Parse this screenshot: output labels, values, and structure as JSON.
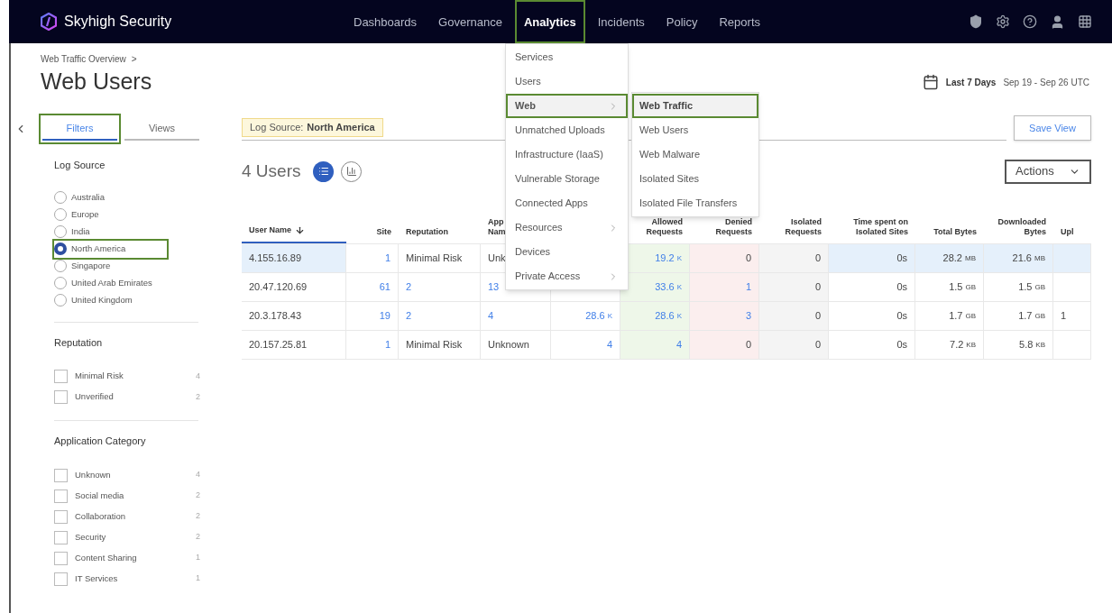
{
  "brand": "Skyhigh Security",
  "nav": [
    {
      "label": "Dashboards",
      "selected": false,
      "outlined": false
    },
    {
      "label": "Governance",
      "selected": false,
      "outlined": false
    },
    {
      "label": "Analytics",
      "selected": true,
      "outlined": true
    },
    {
      "label": "Incidents",
      "selected": false,
      "outlined": false
    },
    {
      "label": "Policy",
      "selected": false,
      "outlined": false
    },
    {
      "label": "Reports",
      "selected": false,
      "outlined": false
    }
  ],
  "menu": [
    {
      "label": "Services",
      "submenu": false,
      "selected": false
    },
    {
      "label": "Users",
      "submenu": false,
      "selected": false
    },
    {
      "label": "Web",
      "submenu": true,
      "selected": true
    },
    {
      "label": "Unmatched Uploads",
      "submenu": false,
      "selected": false
    },
    {
      "label": "Infrastructure (IaaS)",
      "submenu": false,
      "selected": false
    },
    {
      "label": "Vulnerable Storage",
      "submenu": false,
      "selected": false
    },
    {
      "label": "Connected Apps",
      "submenu": false,
      "selected": false
    },
    {
      "label": "Resources",
      "submenu": true,
      "selected": false
    },
    {
      "label": "Devices",
      "submenu": false,
      "selected": false
    },
    {
      "label": "Private Access",
      "submenu": true,
      "selected": false
    }
  ],
  "submenu": [
    {
      "label": "Web Traffic",
      "selected": true
    },
    {
      "label": "Web Users",
      "selected": false
    },
    {
      "label": "Web Malware",
      "selected": false
    },
    {
      "label": "Isolated Sites",
      "selected": false
    },
    {
      "label": "Isolated File Transfers",
      "selected": false
    }
  ],
  "breadcrumb": "Web Traffic Overview",
  "breadcrumb_sep": ">",
  "title": "Web Users",
  "date_range": {
    "label": "Last 7 Days",
    "range": "Sep 19 - Sep 26 UTC"
  },
  "sidebar": {
    "tabs": [
      {
        "label": "Filters",
        "selected": true,
        "outlined": true
      },
      {
        "label": "Views",
        "selected": false,
        "outlined": false
      }
    ],
    "sections": [
      {
        "title": "Log Source",
        "kind": "radio",
        "items": [
          {
            "label": "Australia",
            "selected": false,
            "outlined": false
          },
          {
            "label": "Europe",
            "selected": false,
            "outlined": false
          },
          {
            "label": "India",
            "selected": false,
            "outlined": false
          },
          {
            "label": "North America",
            "selected": true,
            "outlined": true
          },
          {
            "label": "Singapore",
            "selected": false,
            "outlined": false
          },
          {
            "label": "United Arab Emirates",
            "selected": false,
            "outlined": false
          },
          {
            "label": "United Kingdom",
            "selected": false,
            "outlined": false
          }
        ]
      },
      {
        "title": "Reputation",
        "kind": "checkbox",
        "items": [
          {
            "label": "Minimal Risk",
            "count": "4",
            "checked": false
          },
          {
            "label": "Unverified",
            "count": "2",
            "checked": false
          }
        ]
      },
      {
        "title": "Application Category",
        "kind": "checkbox",
        "items": [
          {
            "label": "Unknown",
            "count": "4",
            "checked": false
          },
          {
            "label": "Social media",
            "count": "2",
            "checked": false
          },
          {
            "label": "Collaboration",
            "count": "2",
            "checked": false
          },
          {
            "label": "Security",
            "count": "2",
            "checked": false
          },
          {
            "label": "Content Sharing",
            "count": "1",
            "checked": false
          },
          {
            "label": "IT Services",
            "count": "1",
            "checked": false
          }
        ]
      }
    ]
  },
  "filter_chip": {
    "label": "Log Source:",
    "value": "North America"
  },
  "save_view": "Save View",
  "count_title": "4 Users",
  "views": [
    {
      "kind": "list",
      "selected": true
    },
    {
      "kind": "chart",
      "selected": false
    }
  ],
  "actions": "Actions",
  "table": {
    "columns": [
      {
        "label": "User Name",
        "sorted": true
      },
      {
        "label": "Site",
        "sorted": false
      },
      {
        "label": "Reputation",
        "sorted": false
      },
      {
        "label": "App Nam",
        "sorted": false
      },
      null,
      {
        "label": "Allowed Requests",
        "sorted": false
      },
      {
        "label": "Denied Requests",
        "sorted": false
      },
      {
        "label": "Isolated Requests",
        "sorted": false
      },
      {
        "label": "Time spent on Isolated Sites",
        "sorted": false
      },
      {
        "label": "Total Bytes",
        "sorted": false
      },
      {
        "label": "Downloaded Bytes",
        "sorted": false
      },
      {
        "label": "Upl",
        "sorted": false
      }
    ],
    "rows": [
      {
        "selected": true,
        "cells": [
          {
            "v": "4.155.16.89",
            "link": false
          },
          {
            "v": "1",
            "link": true
          },
          {
            "v": "Minimal Risk",
            "link": false
          },
          {
            "v": "Unk",
            "link": false
          },
          null,
          {
            "v": "19.2",
            "unit": "K",
            "link": true
          },
          {
            "v": "0",
            "link": false
          },
          {
            "v": "0",
            "link": false
          },
          {
            "v": "0s",
            "link": false
          },
          {
            "v": "28.2",
            "unit": "MB",
            "link": false
          },
          {
            "v": "21.6",
            "unit": "MB",
            "link": false
          },
          null
        ]
      },
      {
        "selected": false,
        "cells": [
          {
            "v": "20.47.120.69",
            "link": false
          },
          {
            "v": "61",
            "link": true
          },
          {
            "v": "2",
            "link": true
          },
          {
            "v": "13",
            "link": true
          },
          null,
          {
            "v": "33.6",
            "unit": "K",
            "link": true
          },
          {
            "v": "1",
            "link": true
          },
          {
            "v": "0",
            "link": false
          },
          {
            "v": "0s",
            "link": false
          },
          {
            "v": "1.5",
            "unit": "GB",
            "link": false
          },
          {
            "v": "1.5",
            "unit": "GB",
            "link": false
          },
          null
        ]
      },
      {
        "selected": false,
        "cells": [
          {
            "v": "20.3.178.43",
            "link": false
          },
          {
            "v": "19",
            "link": true
          },
          {
            "v": "2",
            "link": true
          },
          {
            "v": "4",
            "link": true
          },
          {
            "v": "28.6",
            "unit": "K",
            "link": true
          },
          {
            "v": "28.6",
            "unit": "K",
            "link": true
          },
          {
            "v": "3",
            "link": true
          },
          {
            "v": "0",
            "link": false
          },
          {
            "v": "0s",
            "link": false
          },
          {
            "v": "1.7",
            "unit": "GB",
            "link": false
          },
          {
            "v": "1.7",
            "unit": "GB",
            "link": false
          },
          {
            "v": "1",
            "link": false
          }
        ]
      },
      {
        "selected": false,
        "cells": [
          {
            "v": "20.157.25.81",
            "link": false
          },
          {
            "v": "1",
            "link": true
          },
          {
            "v": "Minimal Risk",
            "link": false
          },
          {
            "v": "Unknown",
            "link": false
          },
          {
            "v": "4",
            "link": true
          },
          {
            "v": "4",
            "link": true
          },
          {
            "v": "0",
            "link": false
          },
          {
            "v": "0",
            "link": false
          },
          {
            "v": "0s",
            "link": false
          },
          {
            "v": "7.2",
            "unit": "KB",
            "link": false
          },
          {
            "v": "5.8",
            "unit": "KB",
            "link": false
          },
          null
        ]
      }
    ]
  }
}
